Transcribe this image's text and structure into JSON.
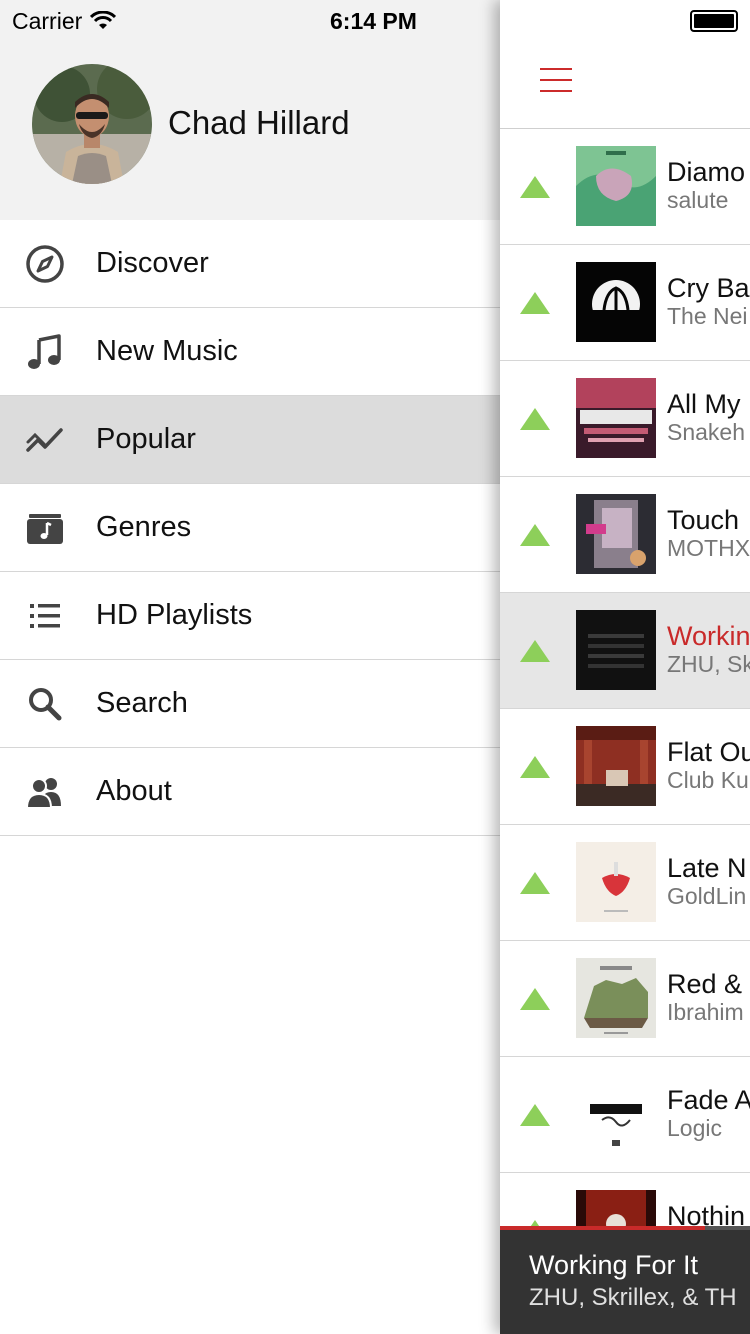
{
  "status_bar": {
    "carrier": "Carrier",
    "time": "6:14 PM"
  },
  "profile": {
    "name": "Chad Hillard"
  },
  "menu": {
    "items": [
      {
        "label": "Discover",
        "icon": "compass-icon",
        "active": false
      },
      {
        "label": "New Music",
        "icon": "music-note-icon",
        "active": false
      },
      {
        "label": "Popular",
        "icon": "trending-icon",
        "active": true
      },
      {
        "label": "Genres",
        "icon": "music-folder-icon",
        "active": false
      },
      {
        "label": "HD Playlists",
        "icon": "list-icon",
        "active": false
      },
      {
        "label": "Search",
        "icon": "search-icon",
        "active": false
      },
      {
        "label": "About",
        "icon": "people-icon",
        "active": false
      }
    ]
  },
  "tracks": [
    {
      "title": "Diamo",
      "artist": "salute",
      "playing": false
    },
    {
      "title": "Cry Ba",
      "artist": "The Nei",
      "playing": false
    },
    {
      "title": "All My",
      "artist": "Snakeh",
      "playing": false
    },
    {
      "title": "Touch",
      "artist": "MOTHX",
      "playing": false
    },
    {
      "title": "Workin",
      "artist": "ZHU, Sk",
      "playing": true
    },
    {
      "title": "Flat Ou",
      "artist": "Club Ku",
      "playing": false
    },
    {
      "title": "Late N",
      "artist": "GoldLin",
      "playing": false
    },
    {
      "title": "Red &",
      "artist": "Ibrahim",
      "playing": false
    },
    {
      "title": "Fade A",
      "artist": "Logic",
      "playing": false
    },
    {
      "title": "Nothin",
      "artist": "",
      "playing": false
    }
  ],
  "now_playing": {
    "title": "Working For It",
    "artist": "ZHU, Skrillex, & TH",
    "progress": 0.82
  },
  "colors": {
    "accent_red": "#c92a2a",
    "trend_up_green": "#8dcf5a",
    "drawer_header_bg": "#f2f2f2",
    "active_item_bg": "#dcdcdc",
    "now_playing_bg": "#333333"
  }
}
